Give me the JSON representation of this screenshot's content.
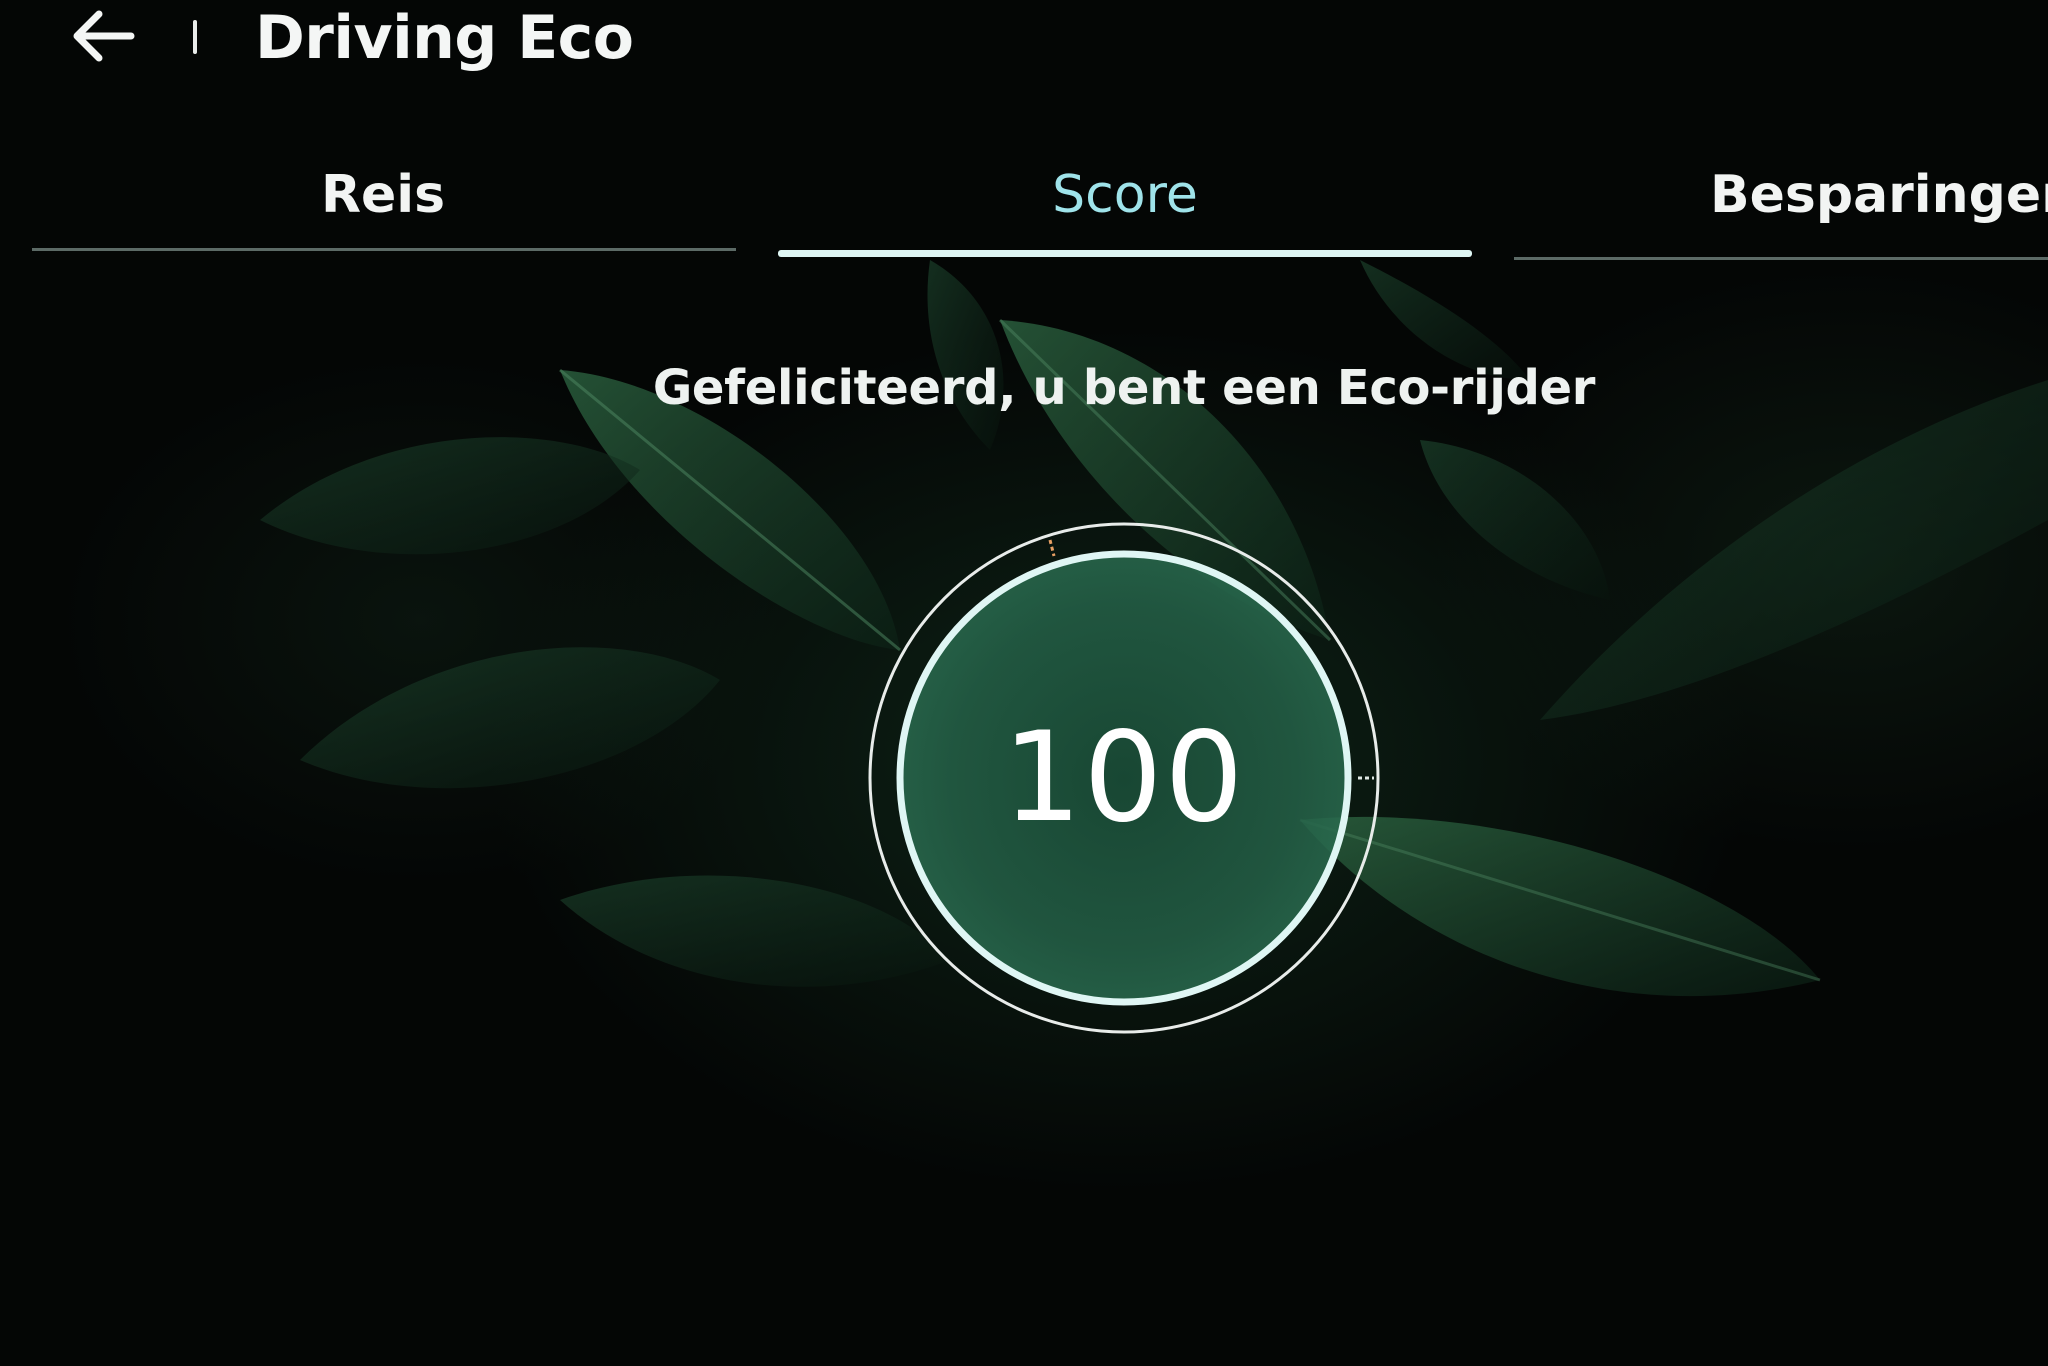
{
  "header": {
    "back_icon": "arrow-left-icon",
    "title": "Driving Eco"
  },
  "tabs": [
    {
      "label": "Reis",
      "selected": false
    },
    {
      "label": "Score",
      "selected": true
    },
    {
      "label": "Besparingen",
      "selected": false
    }
  ],
  "main": {
    "message": "Gefeliciteerd, u bent een Eco-rijder",
    "score": "100",
    "score_fraction": 1.0
  },
  "colors": {
    "active_tab": "#9fe3ea",
    "ring": "#dff6f4",
    "background": "#040605"
  }
}
